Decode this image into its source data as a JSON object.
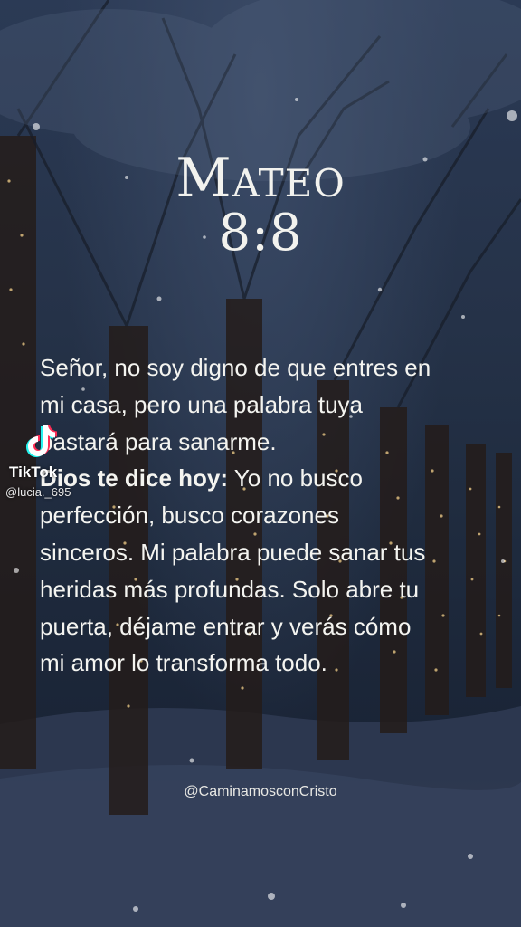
{
  "verse": {
    "book": "Mateo",
    "reference": "8:8"
  },
  "body": {
    "quote": "Señor, no soy digno de que entres en mi casa, pero una palabra tuya bastará para sanarme.",
    "lead_bold": "Dios te dice hoy:",
    "message": " Yo no busco perfección, busco corazones sinceros. Mi palabra puede sanar tus heridas más profundas. Solo abre tu puerta, déjame entrar y verás cómo mi amor lo transforma todo."
  },
  "footer": {
    "handle": "@CaminamosconCristo"
  },
  "watermark": {
    "app_name": "TikTok",
    "username": "@lucia._695",
    "icon": "tiktok-note-icon"
  },
  "colors": {
    "background": "#1e2a3d",
    "text": "#f4f4f0",
    "lights": "#f3d08a"
  }
}
